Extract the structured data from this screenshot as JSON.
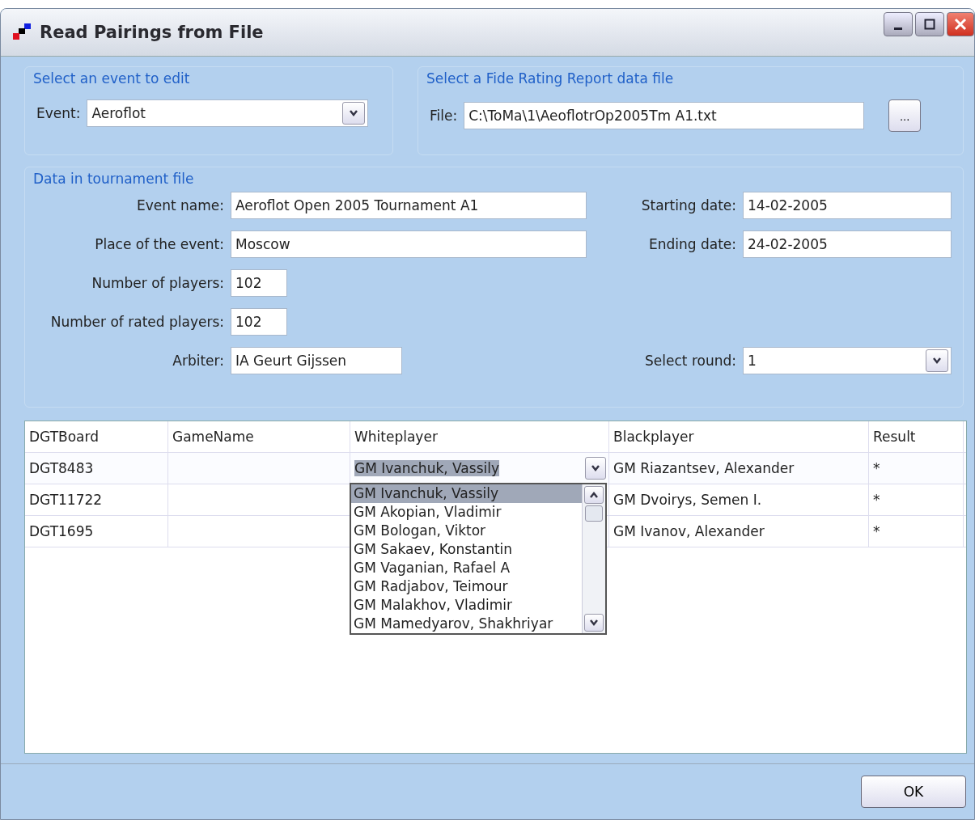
{
  "window": {
    "title": "Read Pairings from File"
  },
  "event_group": {
    "title": "Select an event to edit",
    "label": "Event:",
    "value": "Aeroflot"
  },
  "file_group": {
    "title": "Select a Fide Rating Report data file",
    "label": "File:",
    "value": "C:\\ToMa\\1\\AeoflotrOp2005Tm A1.txt",
    "browse": "..."
  },
  "data_group": {
    "title": "Data in tournament file",
    "left_fields": [
      {
        "label": "Event name:",
        "value": "Aeroflot Open 2005 Tournament A1"
      },
      {
        "label": "Place of the event:",
        "value": "Moscow"
      },
      {
        "label": "Number of players:",
        "value": "102"
      },
      {
        "label": "Number of rated players:",
        "value": "102"
      },
      {
        "label": "Arbiter:",
        "value": "IA Geurt Gijssen"
      }
    ],
    "right_fields": [
      {
        "label": "Starting date:",
        "value": "14-02-2005",
        "kind": "text"
      },
      {
        "label": "Ending date:",
        "value": "24-02-2005",
        "kind": "text"
      },
      {
        "label": "Select round:",
        "value": "1",
        "kind": "combo"
      }
    ]
  },
  "table": {
    "columns": [
      "DGTBoard",
      "GameName",
      "Whiteplayer",
      "Blackplayer",
      "Result"
    ],
    "rows": [
      {
        "board": "DGT8483",
        "white": "GM Ivanchuk, Vassily",
        "black": "GM Riazantsev, Alexander",
        "result": "*",
        "editing": true
      },
      {
        "board": "DGT11722",
        "black": "GM Dvoirys, Semen I.",
        "result": "*",
        "editing": false
      },
      {
        "board": "DGT1695",
        "black": "GM Ivanov, Alexander",
        "result": "*",
        "editing": false
      }
    ],
    "options": [
      {
        "label": "GM Ivanchuk, Vassily",
        "selected": true
      },
      {
        "label": "GM Akopian, Vladimir",
        "selected": false
      },
      {
        "label": "GM Bologan, Viktor",
        "selected": false
      },
      {
        "label": "GM Sakaev, Konstantin",
        "selected": false
      },
      {
        "label": "GM Vaganian, Rafael A",
        "selected": false
      },
      {
        "label": "GM Radjabov, Teimour",
        "selected": false
      },
      {
        "label": "GM Malakhov, Vladimir",
        "selected": false
      },
      {
        "label": "GM Mamedyarov, Shakhriyar",
        "selected": false
      }
    ]
  },
  "buttons": [
    "OK"
  ]
}
